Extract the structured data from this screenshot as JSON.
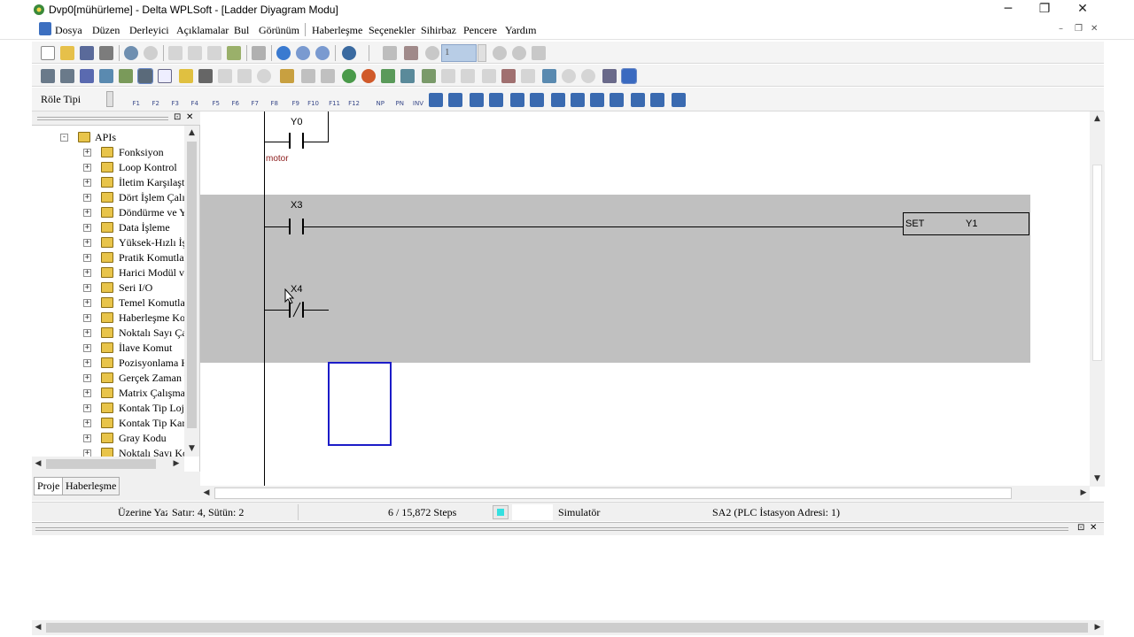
{
  "window": {
    "title": "Dvp0[mühürleme] - Delta WPLSoft - [Ladder Diyagram Modu]",
    "controls": {
      "minimize": "─",
      "restore": "❐",
      "close": "✕"
    }
  },
  "menu": [
    "Dosya",
    "Düzen",
    "Derleyici",
    "Açıklamalar",
    "Bul",
    "Görünüm",
    "Haberleşme",
    "Seçenekler",
    "Sihirbaz",
    "Pencere",
    "Yardım"
  ],
  "toolbar": {
    "step_value": "1",
    "relay_type_label": "Röle Tipi"
  },
  "function_keys": [
    "F1",
    "F2",
    "F3",
    "F4",
    "F5",
    "F6",
    "F7",
    "F8",
    "F9",
    "F10",
    "F11",
    "F12",
    "NP",
    "PN",
    "INV"
  ],
  "tree": {
    "root": "APIs",
    "items": [
      "Fonksiyon",
      "Loop Kontrol",
      "İletim Karşılaştı",
      "Dört İşlem Çalış",
      "Döndürme ve Y",
      "Data İşleme",
      "Yüksek-Hızlı İş",
      "Pratik Komutlar",
      "Harici Modül ve",
      "Seri I/O",
      "Temel Komutlar",
      "Haberleşme Kor",
      "Noktalı Sayı Ça",
      "İlave Komut",
      "Pozisyonlama K",
      "Gerçek Zaman T",
      "Matrix Çalışma",
      "Kontak Tip Loj",
      "Kontak Tip Kar",
      "Gray Kodu",
      "Noktalı Sayı Ko"
    ]
  },
  "panel_tabs": [
    "Proje",
    "Haberleşme"
  ],
  "ladder": {
    "rung0": {
      "contact": "Y0",
      "comment": "motor"
    },
    "rung1": {
      "contact": "X3",
      "instruction": "SET",
      "operand": "Y1"
    },
    "rung2": {
      "contact": "X4"
    }
  },
  "status": {
    "mode": "Üzerine Yaz",
    "position": "Satır: 4, Sütün: 2",
    "steps": "6 / 15,872 Steps",
    "connection": "Simulatör",
    "station": "SA2 (PLC İstasyon Adresi: 1)"
  },
  "colors": {
    "selection_border": "#1c1cc8",
    "rung_highlight": "#c0c0c0",
    "comment_text": "#8b1a1a",
    "status_indicator": "#33e0e0"
  }
}
